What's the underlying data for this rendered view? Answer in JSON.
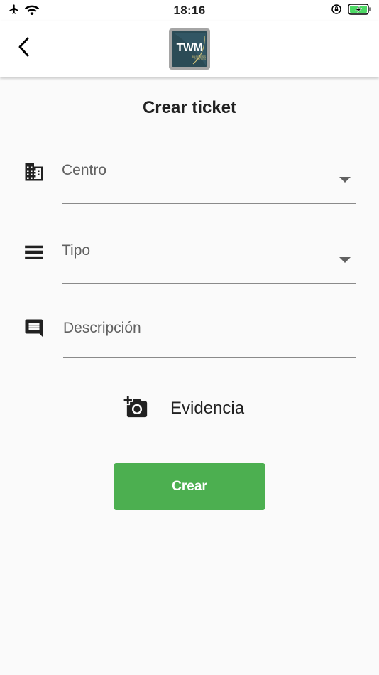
{
  "status_bar": {
    "time": "18:16",
    "icons": [
      "airplane-icon",
      "wifi-icon",
      "rotation-lock-icon",
      "battery-charging-icon"
    ]
  },
  "app_bar": {
    "logo": {
      "text": "TWM",
      "subtext": "BUSINESS CENTER"
    }
  },
  "page": {
    "title": "Crear ticket"
  },
  "form": {
    "centro": {
      "label": "Centro",
      "icon": "building-icon",
      "value": ""
    },
    "tipo": {
      "label": "Tipo",
      "icon": "list-icon",
      "value": ""
    },
    "descripcion": {
      "label": "Descripción",
      "icon": "comment-icon",
      "value": ""
    },
    "evidencia": {
      "label": "Evidencia",
      "icon": "add-a-photo-icon"
    },
    "submit_label": "Crear"
  },
  "colors": {
    "primary": "#4caf50",
    "background": "#fafafa",
    "logo_bg": "#2b4b56",
    "logo_accent": "#d8c77a"
  }
}
